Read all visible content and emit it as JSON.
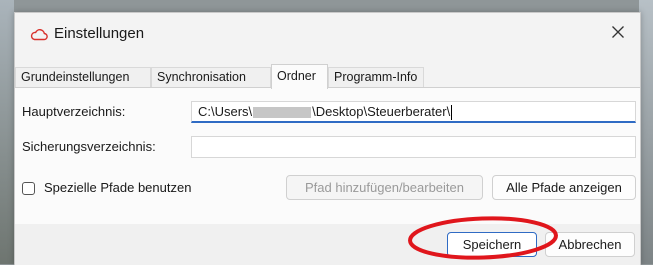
{
  "window": {
    "title": "Einstellungen",
    "close_icon": "close-icon",
    "app_icon": "cloud-icon"
  },
  "tabs": [
    {
      "label": "Grundeinstellungen",
      "active": false
    },
    {
      "label": "Synchronisation",
      "active": false
    },
    {
      "label": "Ordner",
      "active": true
    },
    {
      "label": "Programm-Info",
      "active": false
    }
  ],
  "ordner": {
    "main_dir_label": "Hauptverzeichnis:",
    "main_dir_value_prefix": "C:\\Users\\",
    "main_dir_value_suffix": "\\Desktop\\Steuerberater\\",
    "backup_dir_label": "Sicherungsverzeichnis:",
    "backup_dir_value": "",
    "special_paths_label": "Spezielle Pfade benutzen",
    "special_paths_checked": false,
    "add_path_button": "Pfad hinzufügen/bearbeiten",
    "show_paths_button": "Alle Pfade anzeigen"
  },
  "footer": {
    "save_button": "Speichern",
    "cancel_button": "Abbrechen"
  },
  "colors": {
    "accent": "#2f6bc4",
    "annotation": "#e0161c"
  }
}
